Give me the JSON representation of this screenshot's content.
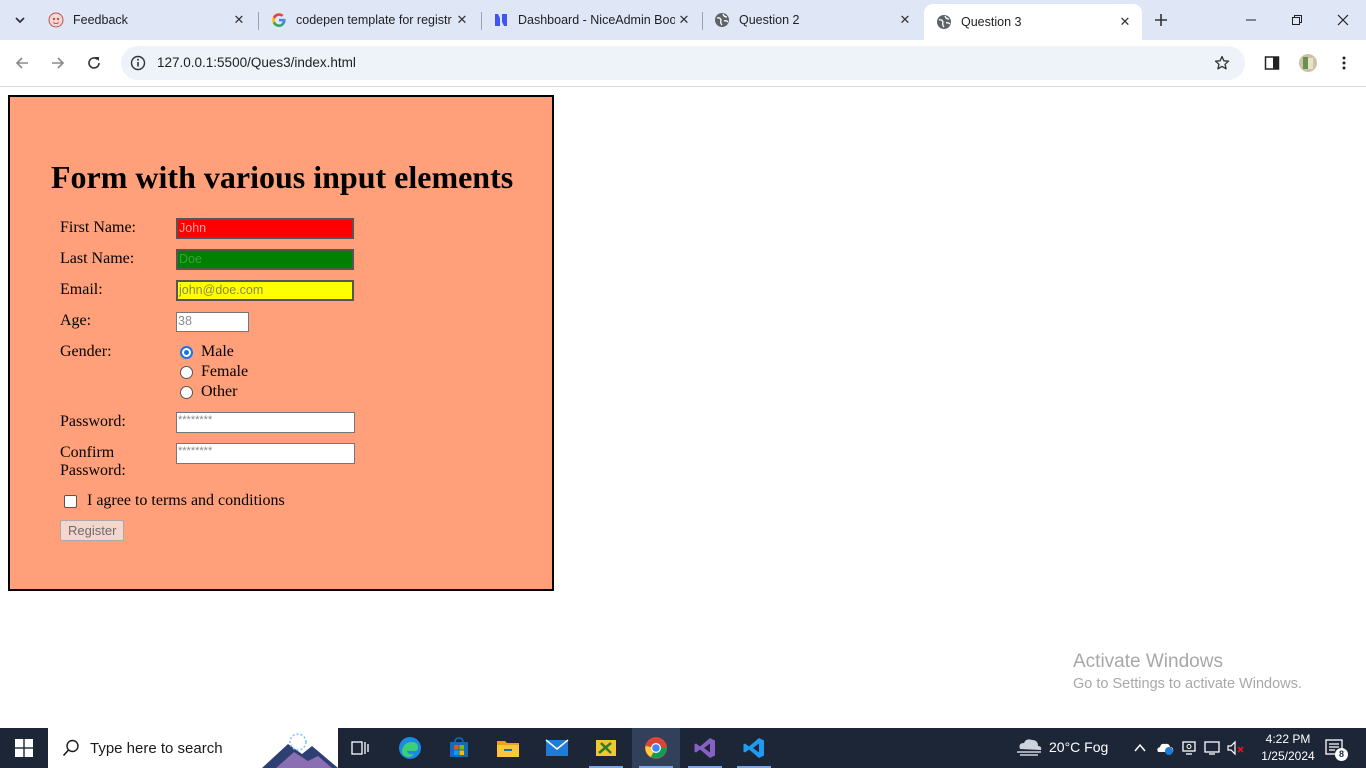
{
  "browser": {
    "tabs": [
      {
        "title": "Feedback",
        "icon": "feedback-favicon",
        "active": false
      },
      {
        "title": "codepen template for registr",
        "icon": "google-favicon",
        "active": false
      },
      {
        "title": "Dashboard - NiceAdmin Boo",
        "icon": "niceadmin-favicon",
        "active": false
      },
      {
        "title": "Question 2",
        "icon": "globe-icon",
        "active": false
      },
      {
        "title": "Question 3",
        "icon": "globe-icon",
        "active": true
      }
    ],
    "url": "127.0.0.1:5500/Ques3/index.html"
  },
  "form": {
    "title": "Form with various input elements",
    "first_name": {
      "label": "First Name:",
      "value": "John"
    },
    "last_name": {
      "label": "Last Name:",
      "value": "Doe"
    },
    "email": {
      "label": "Email:",
      "value": "john@doe.com"
    },
    "age": {
      "label": "Age:",
      "value": "38"
    },
    "gender": {
      "label": "Gender:",
      "options": [
        {
          "label": "Male",
          "checked": true
        },
        {
          "label": "Female",
          "checked": false
        },
        {
          "label": "Other",
          "checked": false
        }
      ]
    },
    "password": {
      "label": "Password:",
      "value": "********"
    },
    "confirm_password": {
      "label_line1": "Confirm",
      "label_line2": "Password:",
      "value": "********"
    },
    "terms": {
      "label": "I agree to terms and conditions",
      "checked": false
    },
    "register_label": "Register",
    "colors": {
      "background": "#ffa07a",
      "first_name_bg": "#ff0000",
      "last_name_bg": "#008000",
      "email_bg": "#ffff00"
    }
  },
  "watermark": {
    "line1": "Activate Windows",
    "line2": "Go to Settings to activate Windows."
  },
  "taskbar": {
    "search_placeholder": "Type here to search",
    "weather": "20°C  Fog",
    "time": "4:22 PM",
    "date": "1/25/2024",
    "notification_count": "8"
  }
}
